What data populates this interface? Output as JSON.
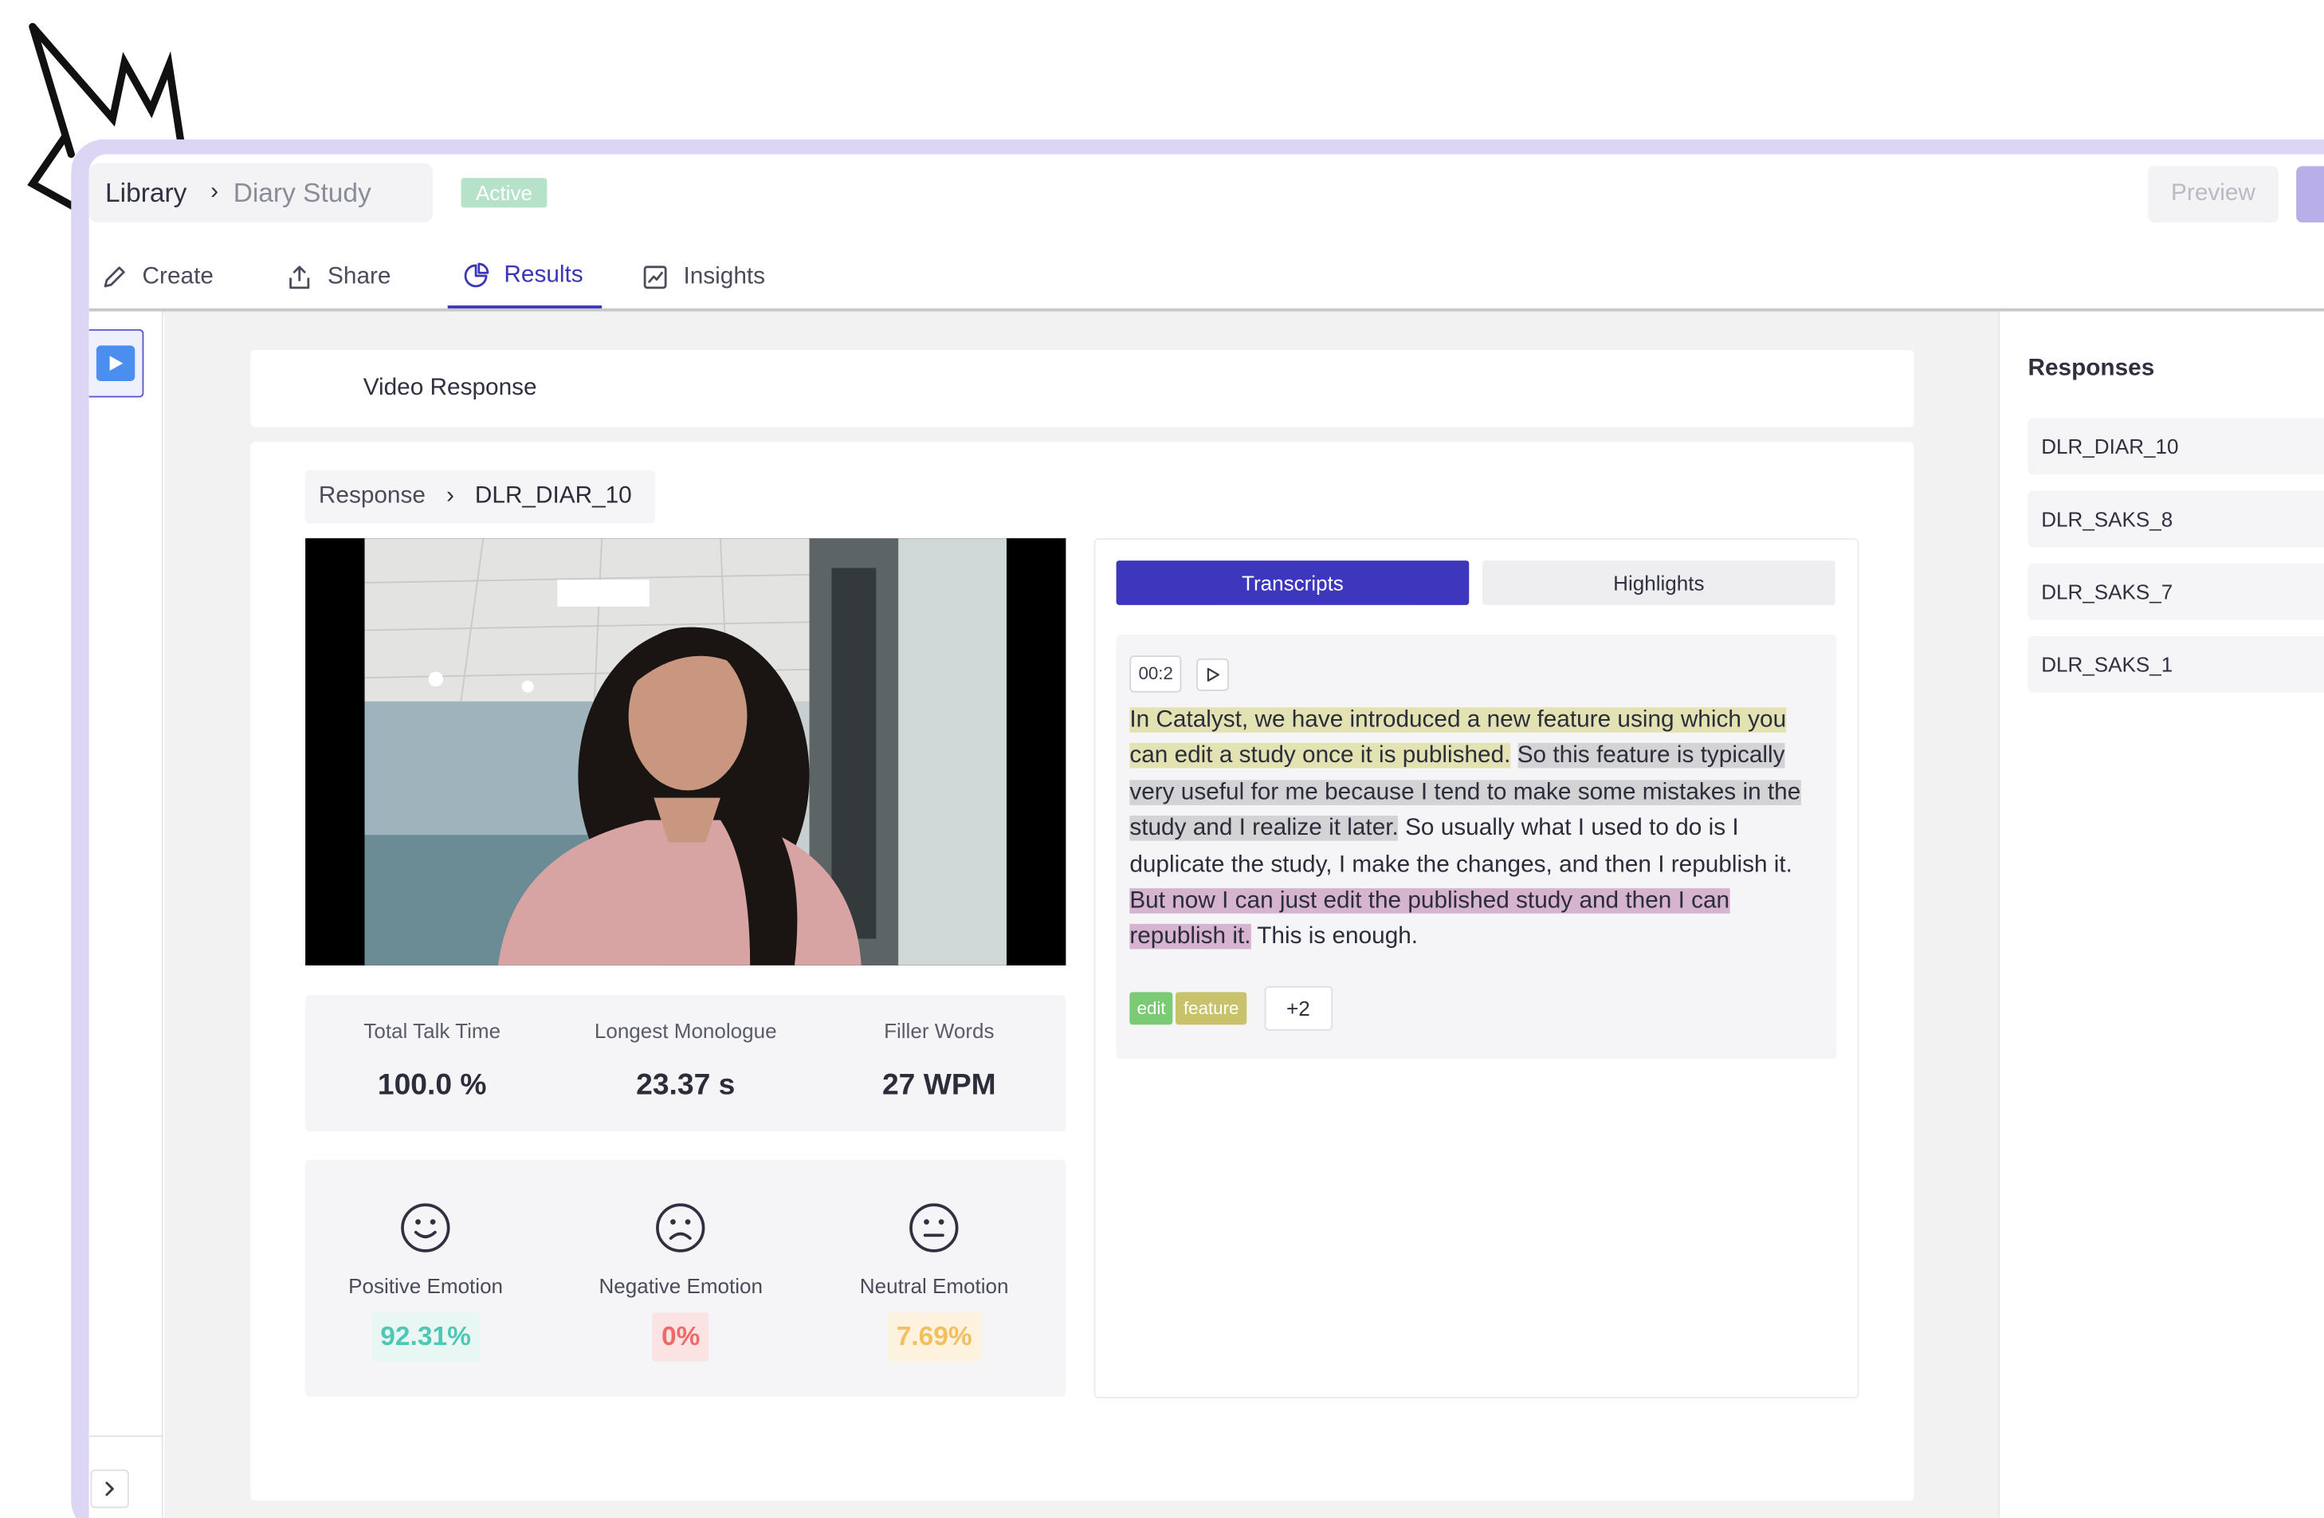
{
  "header": {
    "breadcrumb": {
      "library": "Library",
      "study": "Diary Study"
    },
    "status_badge": "Active",
    "preview_label": "Preview"
  },
  "tabs": [
    {
      "label": "Create",
      "icon": "pencil-icon"
    },
    {
      "label": "Share",
      "icon": "share-icon"
    },
    {
      "label": "Results",
      "icon": "pie-chart-icon",
      "active": true
    },
    {
      "label": "Insights",
      "icon": "line-chart-icon"
    }
  ],
  "main": {
    "card_title": "Video Response",
    "response_crumb": {
      "parent": "Response",
      "current": "DLR_DIAR_10"
    },
    "stats": [
      {
        "label": "Total Talk Time",
        "value": "100.0 %"
      },
      {
        "label": "Longest Monologue",
        "value": "23.37 s"
      },
      {
        "label": "Filler Words",
        "value": "27 WPM"
      }
    ],
    "emotions": [
      {
        "label": "Positive Emotion",
        "value": "92.31%",
        "icon": "smile-face-icon",
        "color": "#4ec7b4"
      },
      {
        "label": "Negative Emotion",
        "value": "0%",
        "icon": "frown-face-icon",
        "color": "#ef6969"
      },
      {
        "label": "Neutral Emotion",
        "value": "7.69%",
        "icon": "neutral-face-icon",
        "color": "#f2bf5c"
      }
    ]
  },
  "transcript": {
    "tab_transcripts": "Transcripts",
    "tab_highlights": "Highlights",
    "timestamp": "00:2",
    "segments": [
      "In Catalyst, we have introduced a new feature using which you can edit a study once it is published.",
      "So this feature is typically very useful for me because I tend to make some mistakes in the study and I realize it later.",
      "So usually what I used to do is I duplicate the study, I make the changes, and then I republish it.",
      "But now I can just edit the published study and then I can republish it.",
      "This is enough."
    ],
    "tags": [
      "edit",
      "feature"
    ],
    "more_tags": "+2"
  },
  "responses": {
    "title": "Responses",
    "items": [
      "DLR_DIAR_10",
      "DLR_SAKS_8",
      "DLR_SAKS_7",
      "DLR_SAKS_1"
    ]
  },
  "colors": {
    "accent": "#3d37be",
    "frame": "#ddd5f4",
    "active_badge": "#b5e2c9"
  }
}
